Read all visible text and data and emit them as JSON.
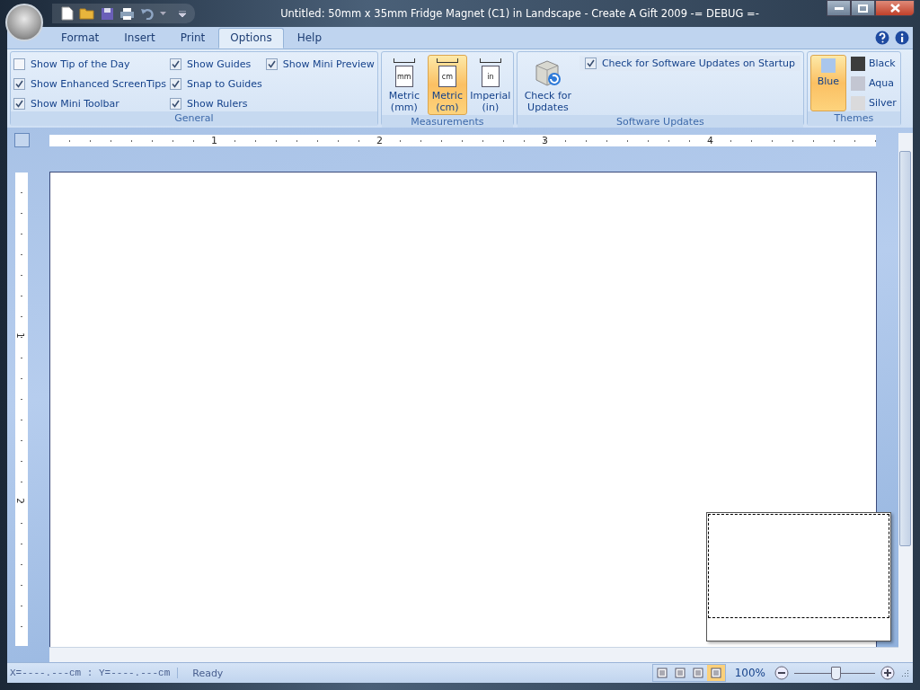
{
  "window": {
    "title": "Untitled: 50mm x 35mm Fridge Magnet (C1) in Landscape - Create A Gift 2009 -= DEBUG =-"
  },
  "tabs": [
    {
      "label": "Format",
      "selected": false
    },
    {
      "label": "Insert",
      "selected": false
    },
    {
      "label": "Print",
      "selected": false
    },
    {
      "label": "Options",
      "selected": true
    },
    {
      "label": "Help",
      "selected": false
    }
  ],
  "ribbon": {
    "groups": [
      {
        "label": "General",
        "kind": "checks",
        "columns": [
          [
            {
              "label": "Show Tip of the Day",
              "checked": false
            },
            {
              "label": "Show Enhanced ScreenTips",
              "checked": true
            },
            {
              "label": "Show Mini Toolbar",
              "checked": true
            }
          ],
          [
            {
              "label": "Show Guides",
              "checked": true
            },
            {
              "label": "Snap to Guides",
              "checked": true
            },
            {
              "label": "Show Rulers",
              "checked": true
            }
          ],
          [
            {
              "label": "Show Mini Preview",
              "checked": true
            }
          ]
        ]
      },
      {
        "label": "Measurements",
        "kind": "units",
        "items": [
          {
            "label": "Metric (mm)",
            "icon_text": "mm",
            "selected": false
          },
          {
            "label": "Metric (cm)",
            "icon_text": "cm",
            "selected": true
          },
          {
            "label": "Imperial (in)",
            "icon_text": "in",
            "selected": false
          }
        ]
      },
      {
        "label": "Software Updates",
        "kind": "updates",
        "button": "Check for Updates",
        "option": {
          "label": "Check for Software Updates on Startup",
          "checked": true
        }
      },
      {
        "label": "Themes",
        "kind": "themes",
        "items": [
          {
            "label": "Blue",
            "color": "#a9c6ec",
            "selected": true
          },
          {
            "label": "Black",
            "color": "#3c3c3c",
            "selected": false
          },
          {
            "label": "Aqua",
            "color": "#c3c6d2",
            "selected": false
          },
          {
            "label": "Silver",
            "color": "#dadadc",
            "selected": false
          }
        ]
      }
    ]
  },
  "rulers": {
    "horizontal": [
      "1",
      "2",
      "3",
      "4"
    ],
    "vertical": [
      "1",
      "2"
    ]
  },
  "status_bar": {
    "coordinates": "X=----.---cm : Y=----.---cm",
    "status": "Ready",
    "views": [
      {
        "selected": false
      },
      {
        "selected": false
      },
      {
        "selected": false
      },
      {
        "selected": true
      }
    ],
    "zoom": "100%",
    "zoom_slider": {
      "level": 0.5
    }
  }
}
